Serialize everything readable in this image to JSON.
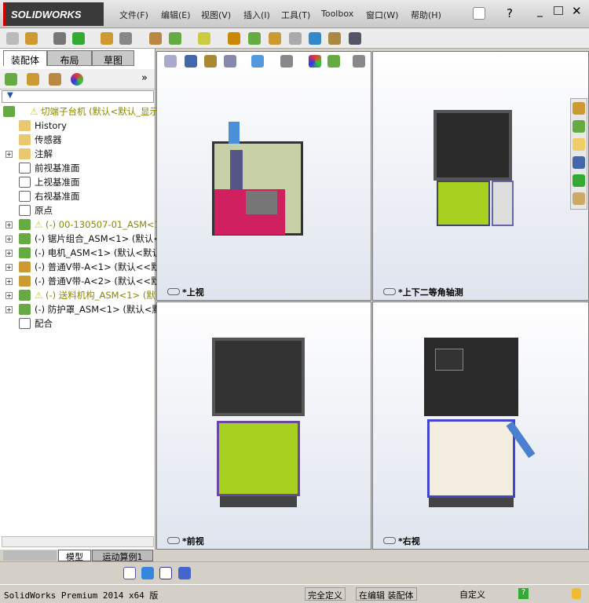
{
  "app": {
    "logo": "SOLIDWORKS"
  },
  "menu": [
    "文件(F)",
    "编辑(E)",
    "视图(V)",
    "插入(I)",
    "工具(T)",
    "Toolbox",
    "窗口(W)",
    "帮助(H)"
  ],
  "left_tabs": [
    "装配体",
    "布局",
    "草图"
  ],
  "tree": [
    {
      "label": "切端子台机  (默认<默认_显示",
      "warn": true,
      "color": "#888800"
    },
    {
      "label": "History"
    },
    {
      "label": "传感器"
    },
    {
      "label": "注解",
      "expand": true
    },
    {
      "label": "前视基准面"
    },
    {
      "label": "上视基准面"
    },
    {
      "label": "右视基准面"
    },
    {
      "label": "原点"
    },
    {
      "label": "(-) 00-130507-01_ASM<1>",
      "expand": true,
      "warn": true
    },
    {
      "label": "(-) 锯片组合_ASM<1> (默认<",
      "expand": true
    },
    {
      "label": "(-) 电机_ASM<1> (默认<默认",
      "expand": true
    },
    {
      "label": "(-) 普通V带-A<1> (默认<<默",
      "expand": true
    },
    {
      "label": "(-) 普通V带-A<2> (默认<<默",
      "expand": true
    },
    {
      "label": "(-) 送料机构_ASM<1> (默",
      "expand": true,
      "warn": true
    },
    {
      "label": "(-) 防护罩_ASM<1> (默认<默",
      "expand": true
    },
    {
      "label": "配合"
    }
  ],
  "bottom_tabs": [
    "模型",
    "运动算例1"
  ],
  "views": [
    "*上视",
    "*上下二等角轴测",
    "*前视",
    "*右视"
  ],
  "status": {
    "version": "SolidWorks Premium 2014 x64 版",
    "state": "完全定义",
    "editing": "在编辑 装配体",
    "custom": "自定义"
  }
}
